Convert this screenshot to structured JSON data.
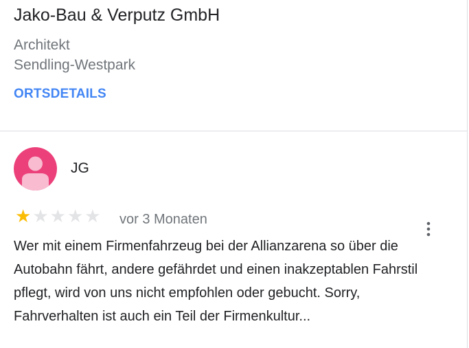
{
  "place": {
    "title": "Jako-Bau & Verputz GmbH",
    "category": "Architekt",
    "location": "Sendling-Westpark",
    "details_link": "ORTSDETAILS"
  },
  "review": {
    "author_initials": "JG",
    "avatar_icon": "person-icon",
    "avatar_color": "#ec407a",
    "rating": 1,
    "rating_max": 5,
    "star_filled_color": "#fbbc04",
    "star_empty_color": "#e3e4e6",
    "time": "vor 3 Monaten",
    "more_icon": "more-vertical-icon",
    "text": "Wer mit einem Firmenfahrzeug bei der Allianzarena so über die Autobahn fährt, andere gefährdet und einen inakzeptablen Fahrstil pflegt, wird von uns nicht empfohlen oder gebucht. Sorry, Fahrverhalten ist auch ein Teil der Firmenkultur..."
  },
  "colors": {
    "link_blue": "#4285f4",
    "text_primary": "#202124",
    "text_secondary": "#70757a"
  }
}
